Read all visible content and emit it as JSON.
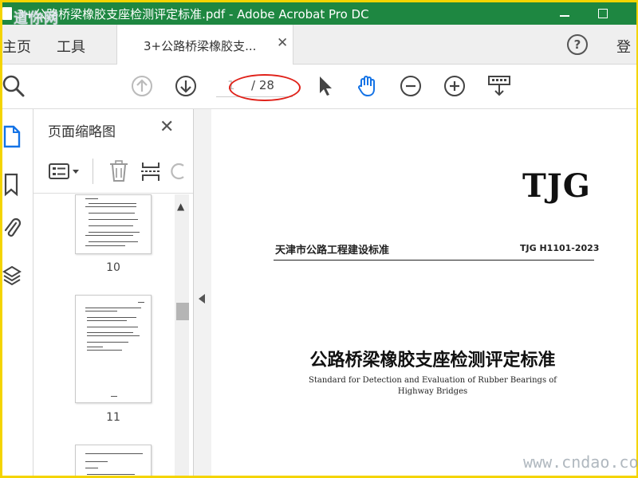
{
  "window": {
    "title": "3+公路桥梁橡胶支座检测评定标准.pdf - Adobe Acrobat Pro DC",
    "watermark_top": "道你网"
  },
  "tabs": {
    "home": "主页",
    "tools": "工具",
    "document_tab": "3+公路桥梁橡胶支...",
    "signin": "登"
  },
  "toolbar": {
    "current_page": "1",
    "total_pages": "/ 28",
    "icons": [
      "search-icon",
      "page-up-icon",
      "page-down-icon",
      "select-cursor-icon",
      "hand-tool-icon",
      "zoom-out-icon",
      "zoom-in-icon",
      "fit-width-icon"
    ]
  },
  "panel": {
    "title": "页面缩略图",
    "thumbnails": [
      {
        "label": "10"
      },
      {
        "label": "11"
      },
      {
        "label": ""
      }
    ]
  },
  "document": {
    "logo": "TJG",
    "issuer": "天津市公路工程建设标准",
    "code": "TJG H1101-2023",
    "title": "公路桥梁橡胶支座检测评定标准",
    "subtitle_line1": "Standard for Detection and Evaluation of Rubber Bearings of",
    "subtitle_line2": "Highway Bridges"
  },
  "watermark_bottom": "www.cndao.com",
  "colors": {
    "titlebar": "#1e8741",
    "frame": "#f4d400",
    "annotation": "#e0221a",
    "accent_blue": "#1473e6"
  }
}
